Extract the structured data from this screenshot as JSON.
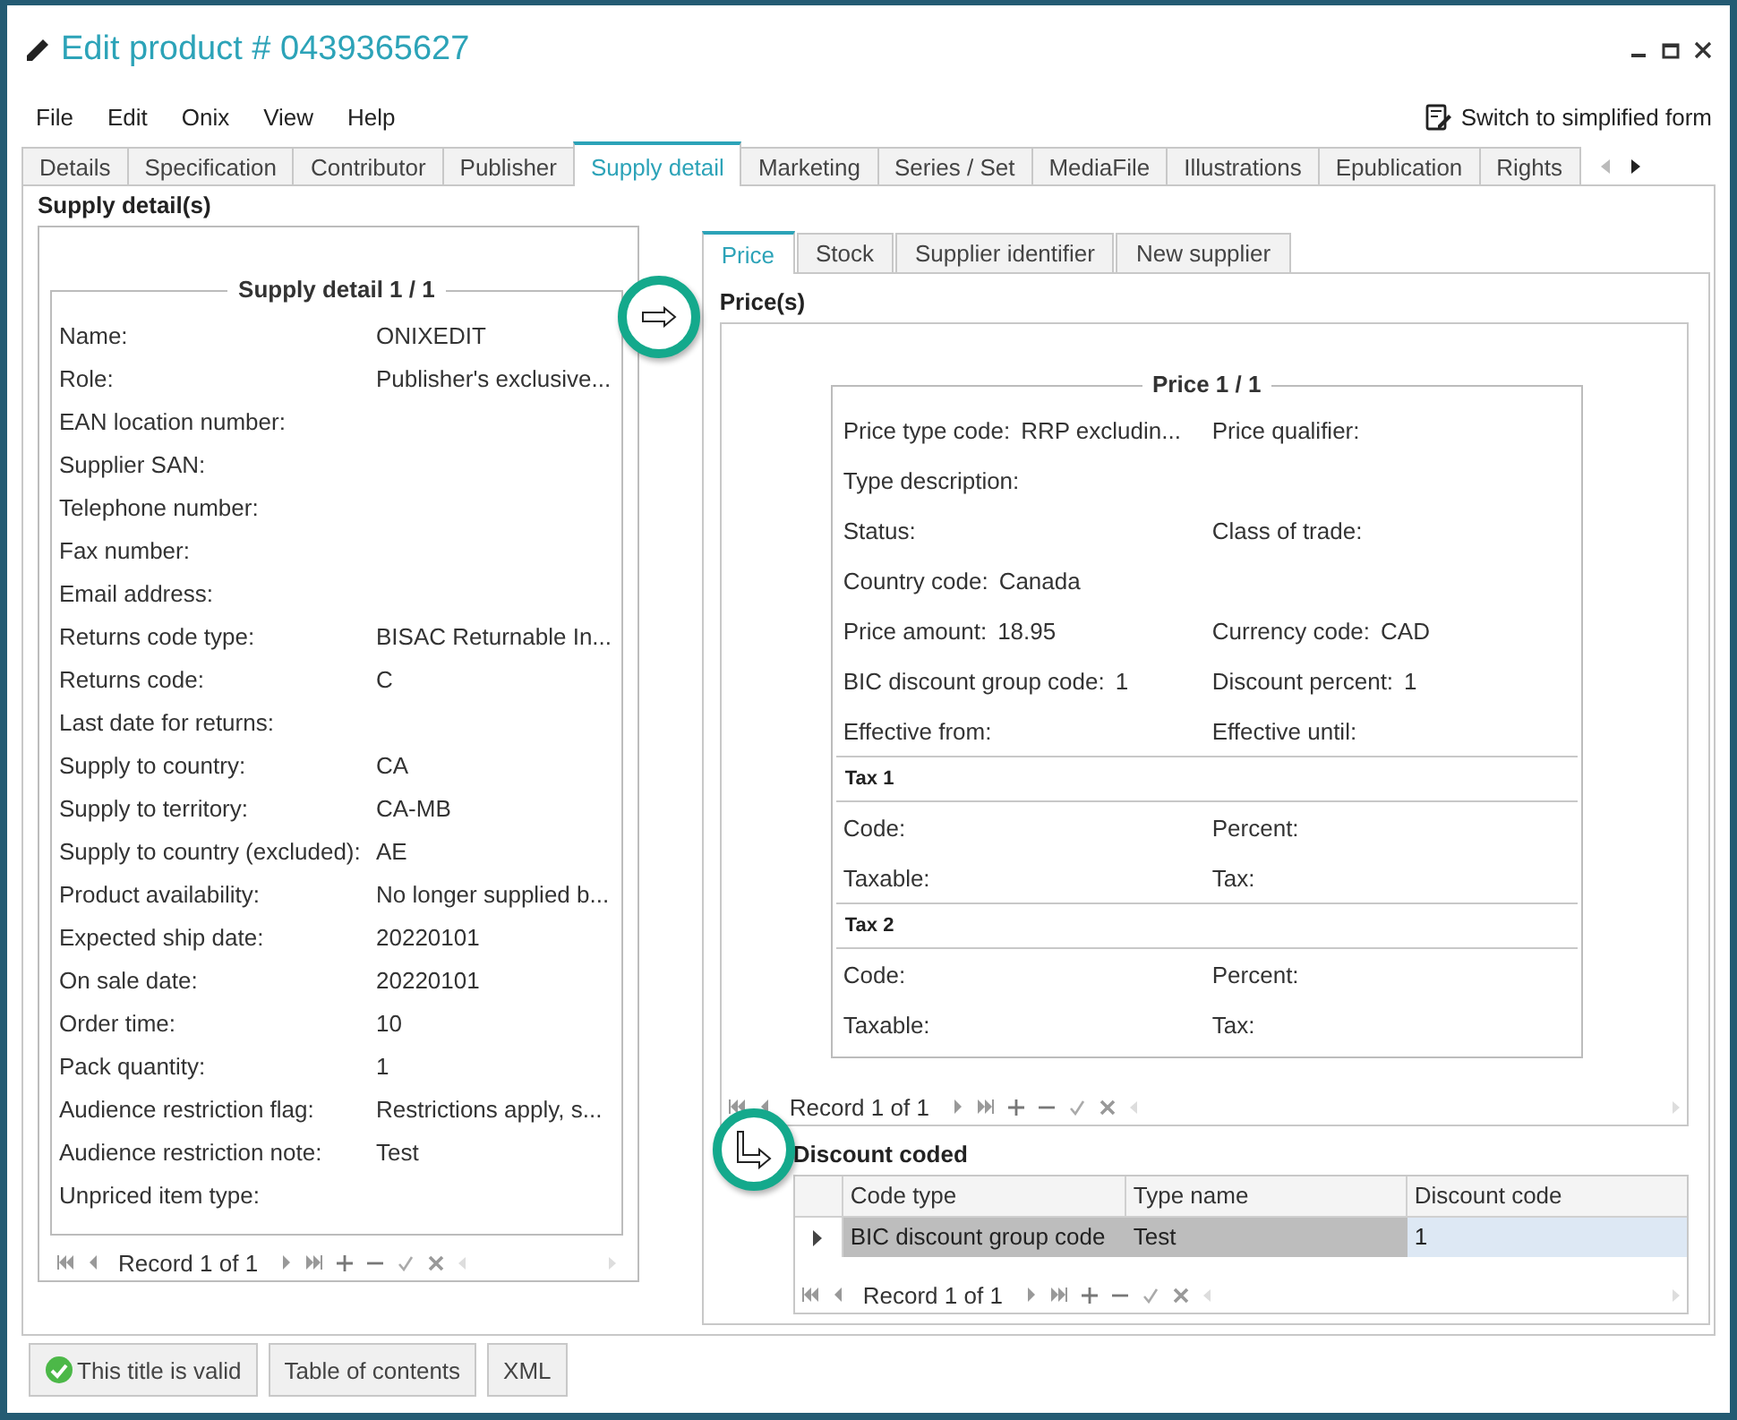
{
  "window": {
    "title": "Edit product # 0439365627"
  },
  "menu": [
    "File",
    "Edit",
    "Onix",
    "View",
    "Help"
  ],
  "switch_link": "Switch to simplified form",
  "tabs": [
    {
      "label": "Details",
      "selected": false
    },
    {
      "label": "Specification",
      "selected": false
    },
    {
      "label": "Contributor",
      "selected": false
    },
    {
      "label": "Publisher",
      "selected": false
    },
    {
      "label": "Supply detail",
      "selected": true
    },
    {
      "label": "Marketing",
      "selected": false
    },
    {
      "label": "Series / Set",
      "selected": false
    },
    {
      "label": "MediaFile",
      "selected": false
    },
    {
      "label": "Illustrations",
      "selected": false
    },
    {
      "label": "Epublication",
      "selected": false
    },
    {
      "label": "Rights",
      "selected": false
    }
  ],
  "supply_section": {
    "title": "Supply detail(s)",
    "legend": "Supply detail 1 / 1",
    "navigator": "Record 1 of 1",
    "fields": [
      {
        "label": "Name:",
        "value": "ONIXEDIT"
      },
      {
        "label": "Role:",
        "value": "Publisher's exclusive..."
      },
      {
        "label": "EAN location number:"
      },
      {
        "label": "Supplier SAN:"
      },
      {
        "label": "Telephone number:"
      },
      {
        "label": "Fax number:"
      },
      {
        "label": "Email address:"
      },
      {
        "label": "Returns code type:",
        "value": "BISAC Returnable In..."
      },
      {
        "label": "Returns code:",
        "value": "C"
      },
      {
        "label": "Last date for returns:"
      },
      {
        "label": "Supply to country:",
        "value": "CA"
      },
      {
        "label": "Supply to territory:",
        "value": "CA-MB"
      },
      {
        "label": "Supply to country (excluded):",
        "value": "AE"
      },
      {
        "label": "Product availability:",
        "value": "No longer supplied b..."
      },
      {
        "label": "Expected ship date:",
        "value": "20220101"
      },
      {
        "label": "On sale date:",
        "value": "20220101"
      },
      {
        "label": "Order time:",
        "value": "10"
      },
      {
        "label": "Pack quantity:",
        "value": "1"
      },
      {
        "label": "Audience restriction flag:",
        "value": "Restrictions apply, s..."
      },
      {
        "label": "Audience restriction note:",
        "value": "Test"
      },
      {
        "label": "Unpriced item type:"
      }
    ]
  },
  "detail_tabs": [
    {
      "label": "Price",
      "selected": true
    },
    {
      "label": "Stock",
      "selected": false
    },
    {
      "label": "Supplier identifier",
      "selected": false
    },
    {
      "label": "New supplier",
      "selected": false
    }
  ],
  "prices": {
    "title": "Price(s)",
    "legend": "Price 1 / 1",
    "navigator": "Record 1 of 1",
    "items": [
      {
        "kind": "pair",
        "fields": [
          {
            "label": "Price type code:",
            "value": "RRP excludin..."
          },
          {
            "label": "Price qualifier:"
          }
        ]
      },
      {
        "kind": "pair",
        "fields": [
          {
            "label": "Type description:"
          }
        ]
      },
      {
        "kind": "pair",
        "fields": [
          {
            "label": "Status:"
          },
          {
            "label": "Class of trade:"
          }
        ]
      },
      {
        "kind": "pair",
        "fields": [
          {
            "label": "Country code:",
            "value": "Canada"
          }
        ]
      },
      {
        "kind": "pair",
        "fields": [
          {
            "label": "Price amount:",
            "value": "18.95"
          },
          {
            "label": "Currency code:",
            "value": "CAD"
          }
        ]
      },
      {
        "kind": "pair",
        "fields": [
          {
            "label": "BIC discount group code:",
            "value": "1"
          },
          {
            "label": "Discount percent:",
            "value": "1"
          }
        ]
      },
      {
        "kind": "pair",
        "fields": [
          {
            "label": "Effective from:"
          },
          {
            "label": "Effective until:"
          }
        ]
      },
      {
        "kind": "heading",
        "text": "Tax 1"
      },
      {
        "kind": "pair",
        "fields": [
          {
            "label": "Code:"
          },
          {
            "label": "Percent:"
          }
        ]
      },
      {
        "kind": "pair",
        "fields": [
          {
            "label": "Taxable:"
          },
          {
            "label": "Tax:"
          }
        ]
      },
      {
        "kind": "heading",
        "text": "Tax 2"
      },
      {
        "kind": "pair",
        "fields": [
          {
            "label": "Code:"
          },
          {
            "label": "Percent:"
          }
        ]
      },
      {
        "kind": "pair",
        "fields": [
          {
            "label": "Taxable:"
          },
          {
            "label": "Tax:"
          }
        ]
      }
    ]
  },
  "discount_coded": {
    "title": "Discount coded",
    "navigator": "Record 1 of 1",
    "columns": [
      "Code type",
      "Type name",
      "Discount code"
    ],
    "rows": [
      {
        "selected": true,
        "cells": [
          {
            "text": "BIC discount group code",
            "focused": false
          },
          {
            "text": "Test",
            "focused": false
          },
          {
            "text": "1",
            "focused": true
          }
        ]
      }
    ]
  },
  "buttons": [
    {
      "label": "This title is valid",
      "kind": "valid"
    },
    {
      "label": "Table of contents",
      "kind": "plain"
    },
    {
      "label": "XML",
      "kind": "plain"
    }
  ]
}
